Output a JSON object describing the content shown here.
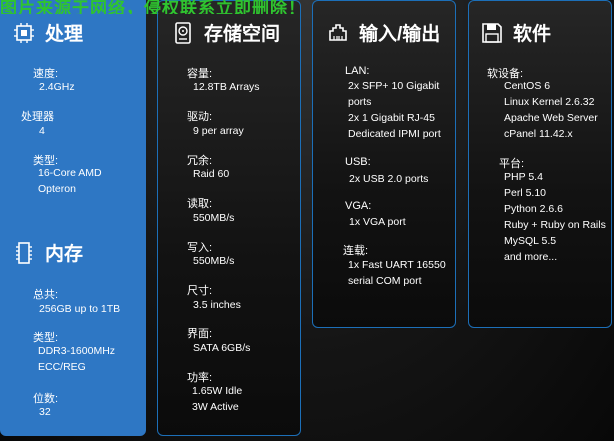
{
  "banner": "图片来源于网络，侵权联系立即删除！",
  "columns": {
    "processing": {
      "title": "处理",
      "specs": [
        {
          "label": "速度:",
          "value": "2.4GHz"
        },
        {
          "label": "处理器",
          "value": "4"
        },
        {
          "label": "类型:",
          "value": "16-Core AMD\nOpteron"
        }
      ]
    },
    "memory": {
      "title": "内存",
      "specs": [
        {
          "label": "总共:",
          "value": "256GB up to 1TB"
        },
        {
          "label": "类型:",
          "value": "DDR3-1600MHz\nECC/REG"
        },
        {
          "label": "位数:",
          "value": "32"
        }
      ]
    },
    "storage": {
      "title": "存储空间",
      "specs": [
        {
          "label": "容量:",
          "value": "12.8TB Arrays"
        },
        {
          "label": "驱动:",
          "value": "9 per array"
        },
        {
          "label": "冗余:",
          "value": "Raid 60"
        },
        {
          "label": "读取:",
          "value": "550MB/s"
        },
        {
          "label": "写入:",
          "value": "550MB/s"
        },
        {
          "label": "尺寸:",
          "value": "3.5 inches"
        },
        {
          "label": "界面:",
          "value": "SATA 6GB/s"
        },
        {
          "label": "功率:",
          "value": "1.65W Idle\n3W Active"
        }
      ]
    },
    "io": {
      "title": "输入/输出",
      "specs": [
        {
          "label": "LAN:",
          "value": "2x SFP+ 10 Gigabit\nports\n2x 1 Gigabit RJ-45\nDedicated IPMI port"
        },
        {
          "label": "USB:",
          "value": "2x USB 2.0 ports"
        },
        {
          "label": "VGA:",
          "value": "1x VGA port"
        },
        {
          "label": "连载:",
          "value": "1x Fast UART 16550\nserial COM port"
        }
      ]
    },
    "software": {
      "title": "软件",
      "specs": [
        {
          "label": "软设备:",
          "value": "CentOS 6\nLinux Kernel 2.6.32\nApache Web Server\ncPanel 11.42.x"
        },
        {
          "label": "平台:",
          "value": "PHP 5.4\nPerl 5.10\nPython 2.6.6\nRuby + Ruby on Rails\nMySQL 5.5\nand more..."
        }
      ]
    }
  }
}
